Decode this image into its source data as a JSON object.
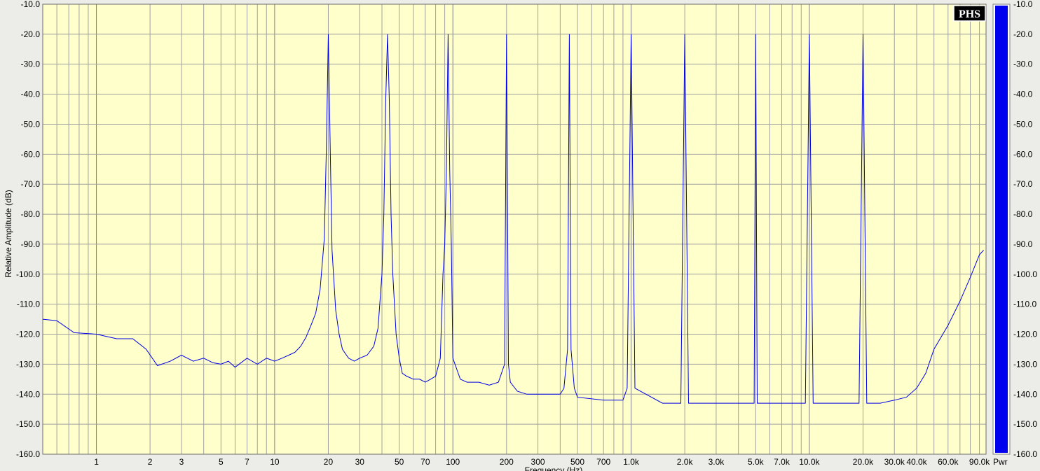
{
  "chart_data": {
    "type": "line",
    "title": "",
    "xlabel": "Frequency (Hz)",
    "ylabel": "Relative Amplitude (dB)",
    "x_scale": "log",
    "xlim": [
      0.5,
      98000
    ],
    "ylim": [
      -160,
      -10
    ],
    "grid": true,
    "x_tick_labels": [
      {
        "v": 1,
        "t": "1"
      },
      {
        "v": 2,
        "t": "2"
      },
      {
        "v": 3,
        "t": "3"
      },
      {
        "v": 5,
        "t": "5"
      },
      {
        "v": 7,
        "t": "7"
      },
      {
        "v": 10,
        "t": "10"
      },
      {
        "v": 20,
        "t": "20"
      },
      {
        "v": 30,
        "t": "30"
      },
      {
        "v": 50,
        "t": "50"
      },
      {
        "v": 70,
        "t": "70"
      },
      {
        "v": 100,
        "t": "100"
      },
      {
        "v": 200,
        "t": "200"
      },
      {
        "v": 300,
        "t": "300"
      },
      {
        "v": 500,
        "t": "500"
      },
      {
        "v": 700,
        "t": "700"
      },
      {
        "v": 1000,
        "t": "1.0k"
      },
      {
        "v": 2000,
        "t": "2.0k"
      },
      {
        "v": 3000,
        "t": "3.0k"
      },
      {
        "v": 5000,
        "t": "5.0k"
      },
      {
        "v": 7000,
        "t": "7.0k"
      },
      {
        "v": 10000,
        "t": "10.0k"
      },
      {
        "v": 20000,
        "t": "20.0k"
      },
      {
        "v": 30000,
        "t": "30.0k"
      },
      {
        "v": 40000,
        "t": "40.0k"
      },
      {
        "v": 60000,
        "t": "60.0k"
      },
      {
        "v": 90000,
        "t": "90.0k"
      }
    ],
    "y_ticks": [
      -10,
      -20,
      -30,
      -40,
      -50,
      -60,
      -70,
      -80,
      -90,
      -100,
      -110,
      -120,
      -130,
      -140,
      -150,
      -160
    ],
    "y_tick_labels": [
      "-10.0",
      "-20.0",
      "-30.0",
      "-40.0",
      "-50.0",
      "-60.0",
      "-70.0",
      "-80.0",
      "-90.0",
      "-100.0",
      "-110.0",
      "-120.0",
      "-130.0",
      "-140.0",
      "-150.0",
      "-160.0"
    ],
    "series": [
      {
        "color": "#0000e6",
        "x": [
          0.5,
          0.6,
          0.75,
          1.0,
          1.3,
          1.6,
          1.9,
          2.2,
          2.6,
          3.0,
          3.5,
          4.0,
          4.5,
          5.0,
          5.5,
          6.0,
          7.0,
          8.0,
          9.0,
          10,
          11,
          12,
          13,
          14,
          15,
          16,
          17,
          18,
          19,
          19.5,
          20,
          20.5,
          21,
          22,
          23,
          24,
          26,
          28,
          30,
          33,
          36,
          38,
          40,
          41,
          42,
          43,
          44,
          45,
          46,
          48,
          50,
          52,
          55,
          60,
          65,
          70,
          75,
          80,
          85,
          88,
          90,
          92,
          94,
          96,
          98,
          100,
          110,
          120,
          140,
          160,
          180,
          195,
          200,
          205,
          210,
          230,
          260,
          300,
          350,
          400,
          420,
          440,
          450,
          460,
          480,
          500,
          700,
          900,
          950,
          1000,
          1050,
          1500,
          1900,
          2000,
          2100,
          3000,
          4500,
          4900,
          5000,
          5100,
          7000,
          9000,
          9500,
          10000,
          10500,
          15000,
          19000,
          20000,
          21000,
          25000,
          30000,
          35000,
          40000,
          45000,
          50000,
          60000,
          70000,
          80000,
          90000,
          95000
        ],
        "y": [
          -115,
          -115.5,
          -119.5,
          -120,
          -121.5,
          -121.5,
          -125,
          -130.5,
          -129,
          -127,
          -129,
          -128,
          -129.5,
          -130,
          -129,
          -131,
          -128,
          -130,
          -128,
          -129,
          -128,
          -127,
          -126,
          -124,
          -121,
          -117,
          -113,
          -105,
          -88,
          -58,
          -20,
          -58,
          -92,
          -112,
          -120,
          -125,
          -128,
          -129,
          -128,
          -127,
          -124,
          -118,
          -100,
          -80,
          -42,
          -20,
          -42,
          -80,
          -100,
          -120,
          -128,
          -133,
          -134,
          -135,
          -135,
          -136,
          -135,
          -134,
          -128,
          -100,
          -90,
          -65,
          -20,
          -65,
          -90,
          -128,
          -135,
          -136,
          -136,
          -137,
          -136,
          -130,
          -20,
          -130,
          -136,
          -139,
          -140,
          -140,
          -140,
          -140,
          -138,
          -125,
          -20,
          -125,
          -138,
          -141,
          -142,
          -142,
          -138,
          -20,
          -138,
          -143,
          -143,
          -20,
          -143,
          -143,
          -143,
          -143,
          -20,
          -143,
          -143,
          -143,
          -143,
          -20,
          -143,
          -143,
          -143,
          -20,
          -143,
          -143,
          -142,
          -141,
          -138,
          -133,
          -125,
          -117,
          -109,
          -101,
          -93.5,
          -92
        ]
      }
    ]
  },
  "meter": {
    "badge": "PHS",
    "unit_label": "Pwr",
    "tick_labels": [
      "-10.0",
      "-20.0",
      "-30.0",
      "-40.0",
      "-50.0",
      "-60.0",
      "-70.0",
      "-80.0",
      "-90.0",
      "-100.0",
      "-110.0",
      "-120.0",
      "-130.0",
      "-140.0",
      "-150.0",
      "-160.0"
    ],
    "level_db": -10,
    "bar_color": "#0000ee"
  }
}
